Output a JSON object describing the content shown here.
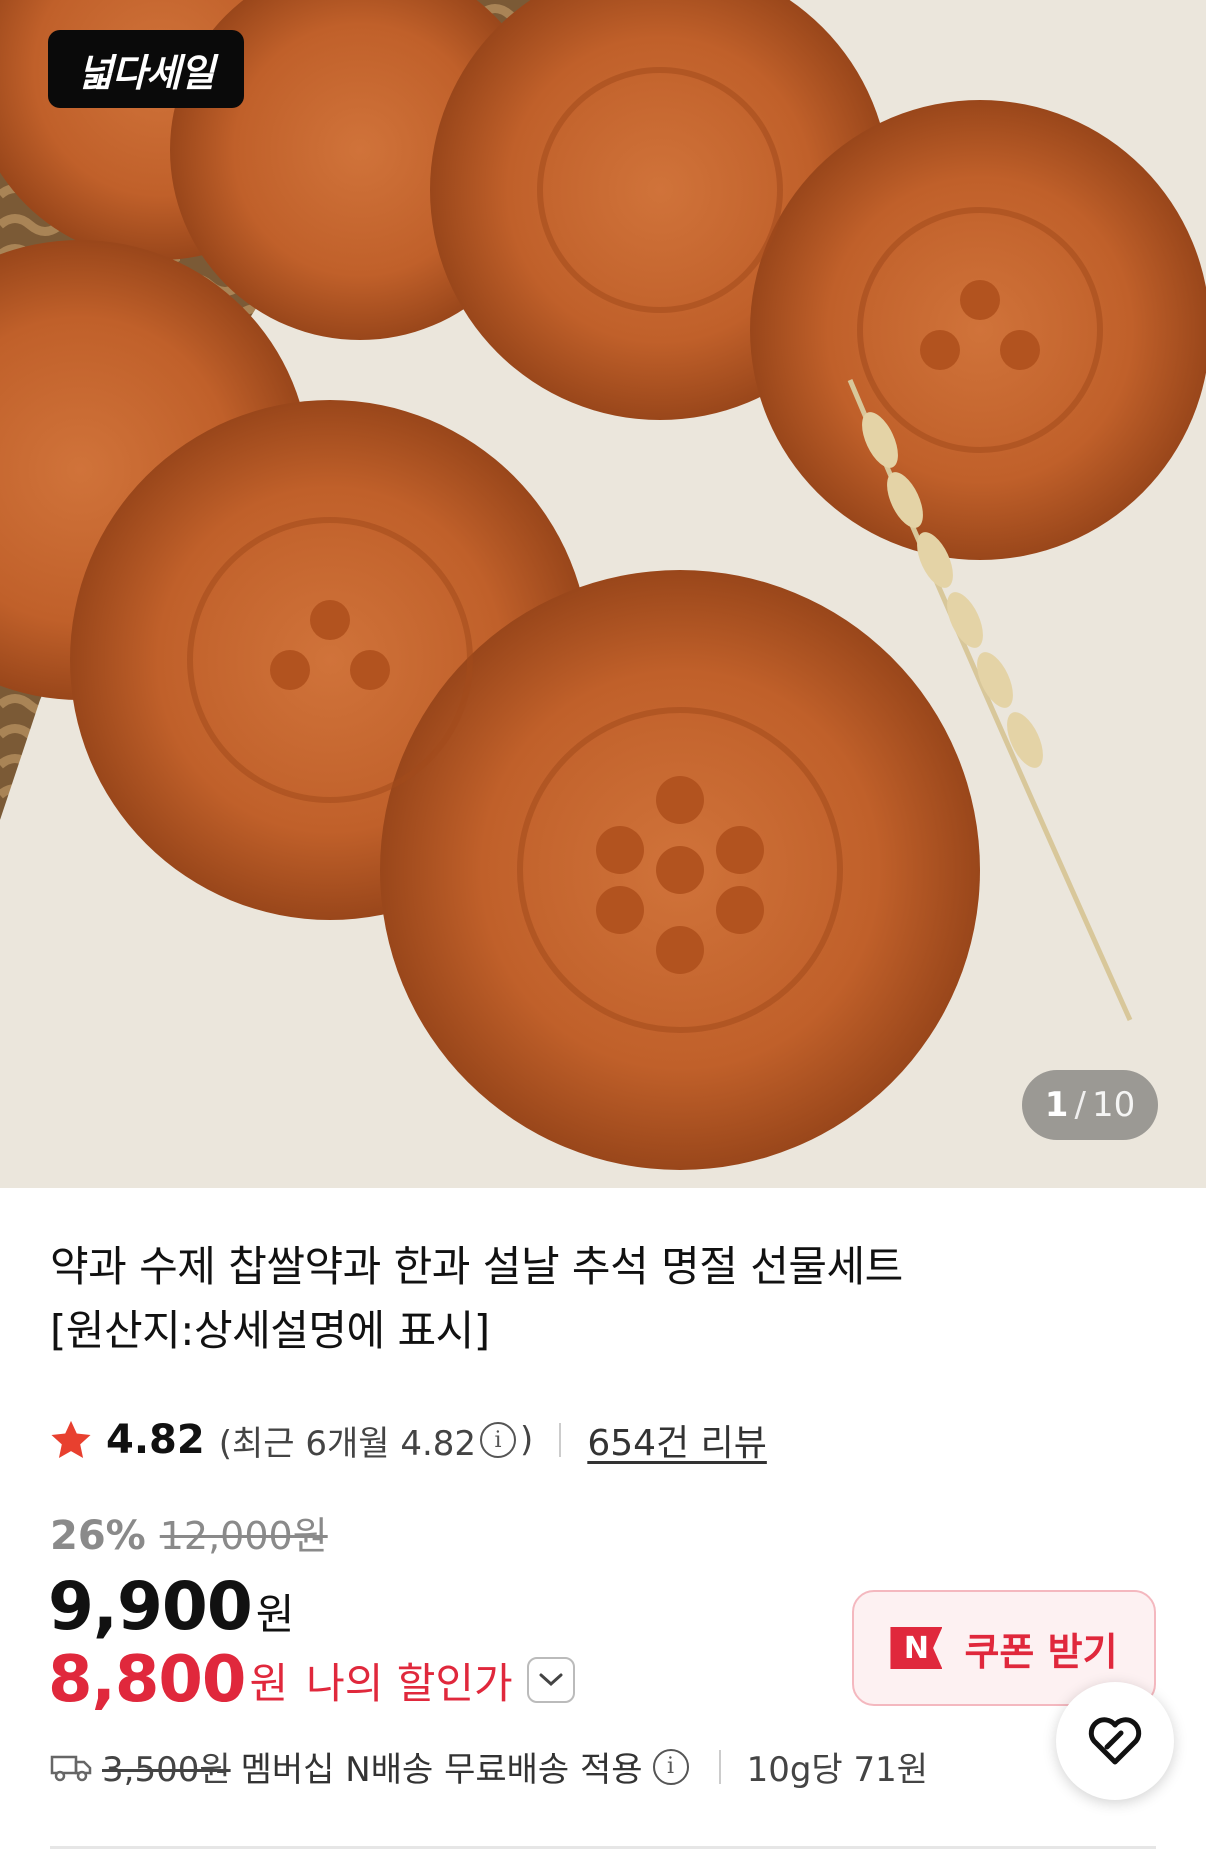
{
  "badge": {
    "label": "넓다세일"
  },
  "gallery": {
    "current": "1",
    "separator": "/",
    "total": "10"
  },
  "product": {
    "title_line1": "약과 수제 찹쌀약과 한과 설날 추석 명절 선물세트",
    "title_line2": "[원산지:상세설명에 표시]"
  },
  "rating": {
    "score": "4.82",
    "recent_prefix": "(최근 6개월 4.82",
    "recent_suffix": ")",
    "review_link": "654건 리뷰"
  },
  "price": {
    "discount": "26%",
    "original": "12,000원",
    "sale": "9,900",
    "sale_unit": "원",
    "my_price": "8,800",
    "my_unit": "원",
    "my_label": "나의 할인가"
  },
  "coupon": {
    "icon_letter": "N",
    "label": "쿠폰 받기"
  },
  "shipping": {
    "original_fee": "3,500원",
    "text": "멤버십 N배송 무료배송 적용",
    "unit_price": "10g당 71원"
  },
  "colors": {
    "accent": "#e0283c",
    "star": "#e8402f",
    "coupon_bg": "#fdf1f2"
  },
  "icons": [
    "star-icon",
    "info-icon",
    "chevron-down-icon",
    "n-coupon-icon",
    "truck-icon",
    "heart-icon"
  ]
}
